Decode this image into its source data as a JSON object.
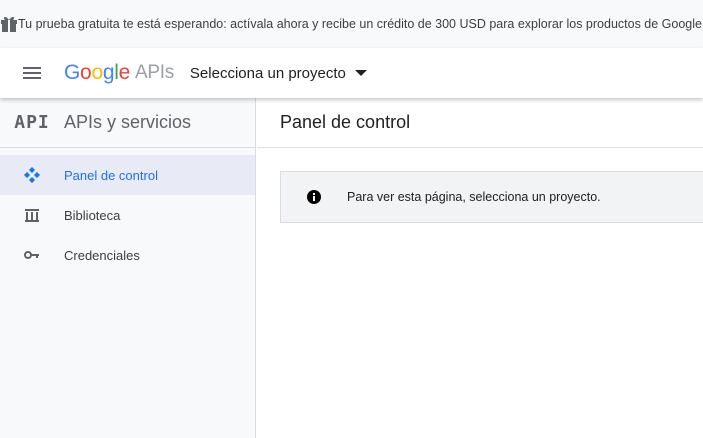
{
  "banner": {
    "icon": "gift-icon",
    "text": "Tu prueba gratuita te está esperando: actívala ahora y recibe un crédito de 300 USD para explorar los productos de Google Cloud."
  },
  "header": {
    "menu_icon": "hamburger-menu-icon",
    "logo": {
      "google": [
        "G",
        "o",
        "o",
        "g",
        "l",
        "e"
      ],
      "product": "APIs"
    },
    "project_selector": "Selecciona un proyecto"
  },
  "sidebar": {
    "badge": "API",
    "title": "APIs y servicios",
    "items": [
      {
        "label": "Panel de control",
        "icon": "dashboard-icon",
        "active": true
      },
      {
        "label": "Biblioteca",
        "icon": "library-icon",
        "active": false
      },
      {
        "label": "Credenciales",
        "icon": "key-icon",
        "active": false
      }
    ]
  },
  "main": {
    "title": "Panel de control",
    "notice": "Para ver esta página, selecciona un proyecto.",
    "notice_icon": "info-icon"
  },
  "colors": {
    "accent": "#1a73e8",
    "active_bg": "#e8eaf6",
    "sidebar_bg": "#f8f9fa"
  }
}
